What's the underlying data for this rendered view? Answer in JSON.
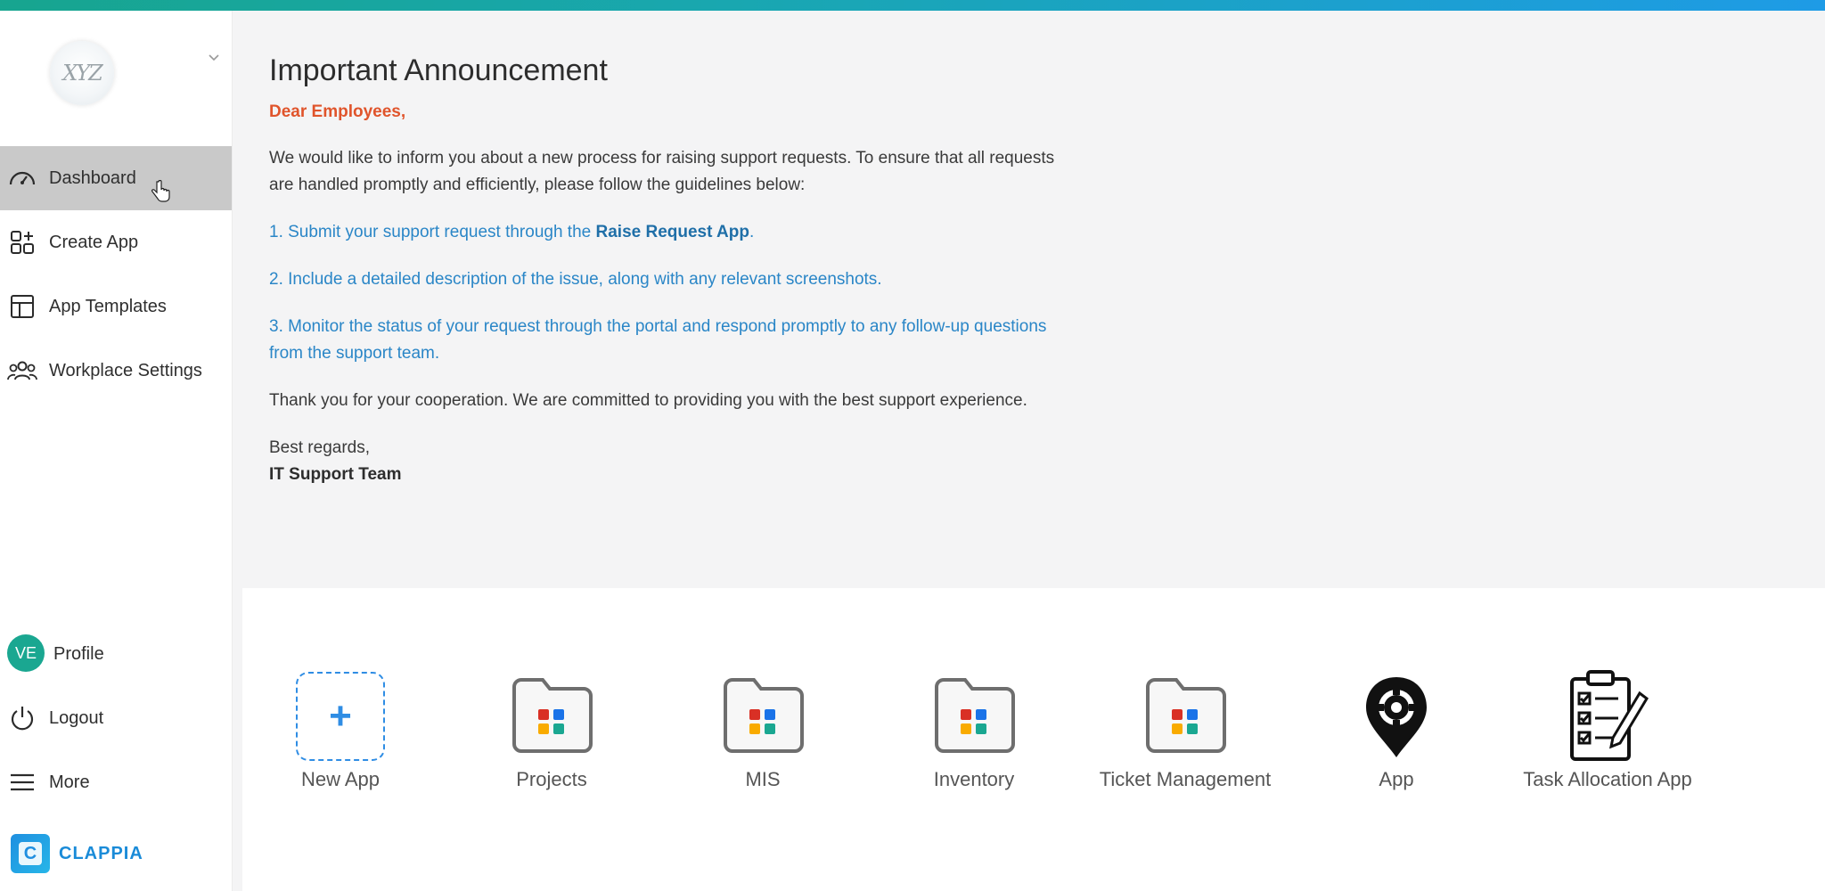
{
  "org": {
    "logo_text": "XYZ"
  },
  "sidebar": {
    "items": [
      {
        "label": "Dashboard",
        "icon": "speedometer-icon"
      },
      {
        "label": "Create App",
        "icon": "grid-plus-icon"
      },
      {
        "label": "App Templates",
        "icon": "layout-icon"
      },
      {
        "label": "Workplace Settings",
        "icon": "users-icon"
      }
    ],
    "bottom": [
      {
        "label": "Profile",
        "icon": "avatar"
      },
      {
        "label": "Logout",
        "icon": "power-icon"
      },
      {
        "label": "More",
        "icon": "menu-icon"
      }
    ],
    "avatar_initials": "VE",
    "brand_letter": "C",
    "brand_name": "CLAPPIA"
  },
  "announcement": {
    "title": "Important Announcement",
    "greeting": "Dear Employees,",
    "intro": "We would like to inform you about a new process for raising support requests. To ensure that all requests are handled promptly and efficiently, please follow the guidelines below:",
    "step1_prefix": "1. Submit your support request through the ",
    "step1_link": "Raise Request App",
    "step1_suffix": ".",
    "step2": "2. Include a detailed description of the issue, along with any relevant screenshots.",
    "step3": "3. Monitor the status of your request through the portal and respond promptly to any follow-up questions from the support team.",
    "thanks": "Thank you for your cooperation. We are committed to providing you with the best support experience.",
    "closing": "Best regards,",
    "signature": "IT Support Team"
  },
  "apps": [
    {
      "label": "New App",
      "icon": "plus-icon"
    },
    {
      "label": "Projects",
      "icon": "folder-app-icon"
    },
    {
      "label": "MIS",
      "icon": "folder-app-icon"
    },
    {
      "label": "Inventory",
      "icon": "folder-app-icon"
    },
    {
      "label": "Ticket Management",
      "icon": "folder-app-icon"
    },
    {
      "label": "App",
      "icon": "location-pin-icon"
    },
    {
      "label": "Task Allocation App",
      "icon": "clipboard-checklist-icon"
    }
  ],
  "colors": {
    "accent": "#1aa791",
    "greeting": "#e0542b",
    "link": "#2a86c7",
    "active_nav": "#c9c9c9"
  }
}
